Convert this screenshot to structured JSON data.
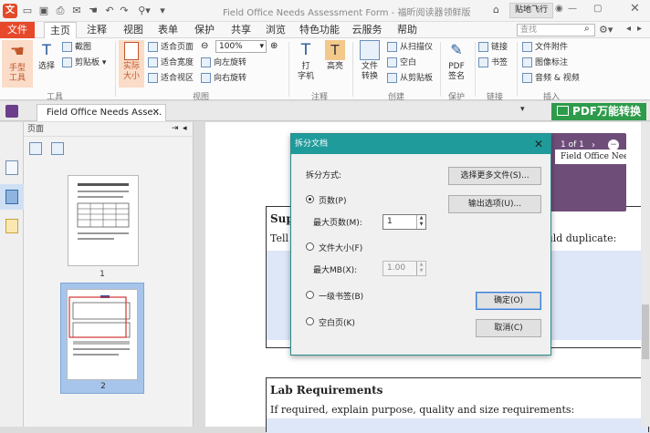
{
  "titlebar": {
    "app_logo": "文",
    "title": "Field Office Needs Assessment Form - 福昕阅读器领鲜版",
    "right_button": "贴地飞行",
    "search_placeholder": "查找"
  },
  "menus": [
    "文件",
    "主页",
    "注释",
    "视图",
    "表单",
    "保护",
    "共享",
    "浏览",
    "特色功能",
    "云服务",
    "帮助"
  ],
  "ribbon": {
    "tools": {
      "hand": "手型\n工具",
      "select": "选择",
      "screenshot": "截图",
      "clipboard": "剪贴板",
      "group": "工具"
    },
    "view": {
      "actual_size": "实际\n大小",
      "fit_page": "适合页面",
      "fit_width": "适合宽度",
      "fit_visible": "适合视区",
      "zoom": "100%",
      "rotate_left": "向左旋转",
      "rotate_right": "向右旋转",
      "group": "视图"
    },
    "comment": {
      "typewriter": "打\n字机",
      "highlight": "高亮",
      "group": "注释"
    },
    "create": {
      "convert": "文件\n转换",
      "from_scanner": "从扫描仪",
      "blank": "空白",
      "from_clipboard": "从剪贴板",
      "group": "创建"
    },
    "protect": {
      "pdf_sign": "PDF\n签名",
      "group": "保护"
    },
    "links": {
      "link": "链接",
      "bookmark": "书签",
      "group": "链接"
    },
    "insert": {
      "attachment": "文件附件",
      "image_annot": "图像标注",
      "audio_video": "音频 & 视频",
      "group": "插入"
    }
  },
  "tabstrip": {
    "doc_tab": "Field Office Needs Asse...",
    "promo": "PDF万能转换"
  },
  "thumbpanel": {
    "header": "页面",
    "pages": [
      "1",
      "2"
    ]
  },
  "document": {
    "page_indicator": "1 of 1",
    "header_text": "Field Office Needs",
    "section1_title": "Sup",
    "section1_text_start": "Tell",
    "section1_text_end": "ould duplicate:",
    "section2_title": "Lab Requirements",
    "section2_text": "If required, explain purpose, quality and size requirements:"
  },
  "dialog": {
    "title": "拆分文档",
    "split_method": "拆分方式:",
    "opt_pages": "页数(P)",
    "max_pages_label": "最大页数(M):",
    "max_pages_value": "1",
    "opt_filesize": "文件大小(F)",
    "max_mb_label": "最大MB(X):",
    "max_mb_value": "1.00",
    "opt_bookmark": "一级书签(B)",
    "opt_blank": "空白页(K)",
    "btn_select_files": "选择更多文件(S)...",
    "btn_output": "输出选项(U)...",
    "btn_ok": "确定(O)",
    "btn_cancel": "取消(C)",
    "close": "✕"
  },
  "colors": {
    "accent": "#e7482a",
    "dialog_title": "#1f9b9b",
    "promo": "#2e9b4a",
    "popup": "#6e4e79"
  }
}
